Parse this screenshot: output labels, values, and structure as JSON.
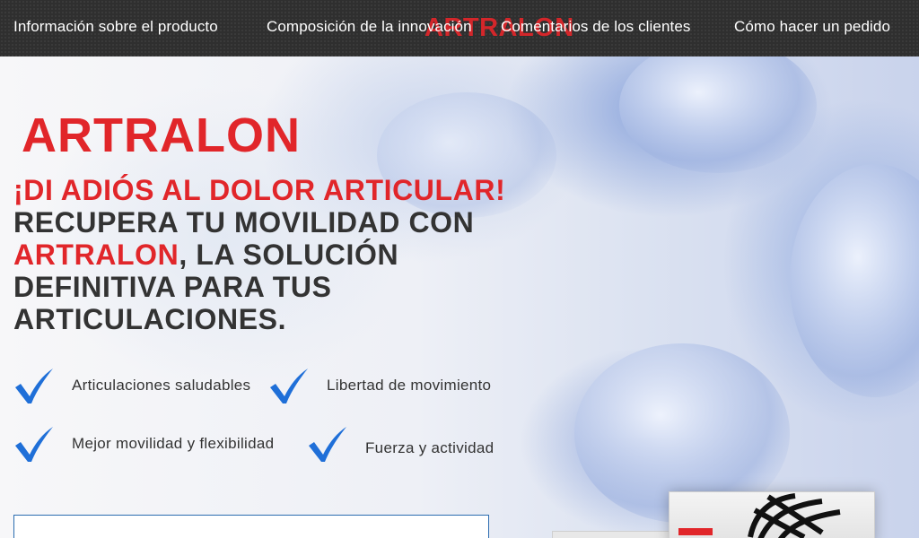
{
  "nav": {
    "items": [
      {
        "label": "Información sobre el producto"
      },
      {
        "label": "Composición de la innovación"
      },
      {
        "label": "Comentarios de los clientes"
      },
      {
        "label": "Cómo hacer un pedido"
      }
    ],
    "logo": "ARTRALON"
  },
  "hero": {
    "logo": "ARTRALON",
    "headline": {
      "line1": "¡DI ADIÓS AL DOLOR ARTICULAR!",
      "line2": "RECUPERA TU MOVILIDAD CON",
      "brand": "ARTRALON",
      "rest": ", LA SOLUCIÓN DEFINITIVA PARA TUS ARTICULACIONES."
    },
    "benefits": [
      {
        "label": "Articulaciones saludables",
        "icon": "check-icon"
      },
      {
        "label": "Libertad de movimiento",
        "icon": "check-icon"
      },
      {
        "label": "Mejor movilidad y flexibilidad",
        "icon": "check-icon"
      },
      {
        "label": "Fuerza y actividad",
        "icon": "check-icon"
      }
    ]
  },
  "colors": {
    "accent": "#e1262a",
    "nav_bg": "#2f2f2f",
    "check": "#1f6fd8",
    "text": "#333333"
  }
}
